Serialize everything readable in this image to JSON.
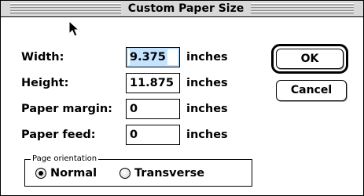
{
  "dialog": {
    "title": "Custom Paper Size"
  },
  "fields": [
    {
      "label": "Width:",
      "value": "9.375",
      "unit": "inches"
    },
    {
      "label": "Height:",
      "value": "11.875",
      "unit": "inches"
    },
    {
      "label": "Paper margin:",
      "value": "0",
      "unit": "inches"
    },
    {
      "label": "Paper feed:",
      "value": "0",
      "unit": "inches"
    }
  ],
  "buttons": {
    "ok_label": "OK",
    "cancel_label": "Cancel"
  },
  "orientation": {
    "caption": "Page orientation",
    "options": [
      {
        "label": "Normal",
        "selected": true
      },
      {
        "label": "Transverse",
        "selected": false
      }
    ]
  },
  "colors": {
    "selection_highlight": "#c4e3ff",
    "titlebar_background": "#d8d8d8"
  },
  "icons": {
    "pointer": "arrow-cursor-icon"
  }
}
